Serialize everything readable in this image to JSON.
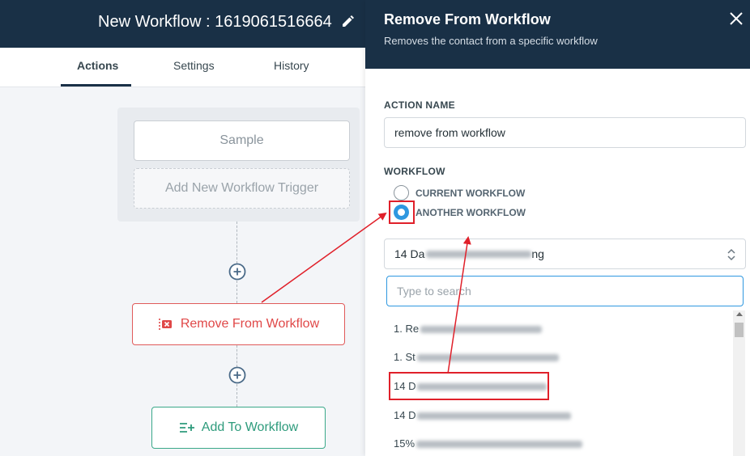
{
  "workflow": {
    "title": "New Workflow : 1619061516664",
    "tabs": [
      "Actions",
      "Settings",
      "History"
    ]
  },
  "canvas": {
    "trigger_sample": "Sample",
    "add_trigger": "Add New Workflow Trigger",
    "node_remove": "Remove From Workflow",
    "node_add": "Add To Workflow"
  },
  "panel": {
    "title": "Remove From Workflow",
    "subtitle": "Removes the contact from a specific workflow",
    "action_name_label": "ACTION NAME",
    "action_name_value": "remove from workflow",
    "workflow_label": "WORKFLOW",
    "radio_current": "CURRENT WORKFLOW",
    "radio_another": "ANOTHER WORKFLOW",
    "select_value_prefix": "14 Da",
    "select_value_suffix": "ng",
    "search_placeholder": "Type to search",
    "options": [
      "1. Re",
      "1. St",
      "14 D",
      "14 D",
      "15%"
    ]
  },
  "colors": {
    "header": "#193046",
    "accent": "#2f98e0",
    "danger": "#e04848",
    "success": "#2e9b7c",
    "annotation": "#e0202a"
  }
}
